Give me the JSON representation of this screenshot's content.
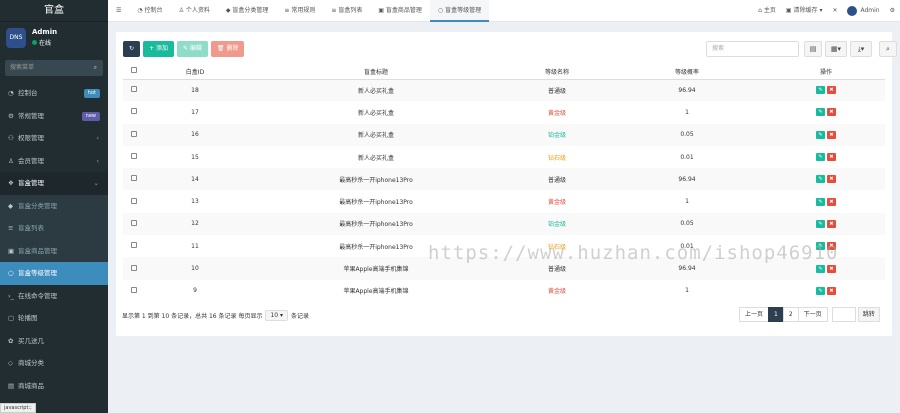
{
  "app": {
    "logo": "官盒",
    "user_name": "Admin",
    "user_status": "在线",
    "avatar_text": "DNS",
    "search_placeholder": "搜索菜单",
    "status_tip": "javascript:;"
  },
  "sidebar": {
    "items": [
      {
        "label": "控制台",
        "badge": "hot",
        "badge_color": "#3c8dbc",
        "icon": "dashboard-icon"
      },
      {
        "label": "常规管理",
        "badge": "new",
        "badge_color": "#605ca8",
        "icon": "cog-icon"
      },
      {
        "label": "权限管理",
        "chevron": "‹",
        "icon": "group-icon"
      },
      {
        "label": "会员管理",
        "chevron": "‹",
        "icon": "user-icon"
      },
      {
        "label": "盲盒管理",
        "chevron": "⌄",
        "icon": "cubes-icon",
        "state": "open"
      },
      {
        "label": "盲盒分类管理",
        "icon": "cube-icon",
        "state": "sub"
      },
      {
        "label": "盲盒列表",
        "icon": "list-icon",
        "state": "sub"
      },
      {
        "label": "盲盒商品管理",
        "icon": "box-icon",
        "state": "sub"
      },
      {
        "label": "盲盒等级管理",
        "icon": "circle-icon",
        "state": "active"
      },
      {
        "label": "在线命令管理",
        "icon": "terminal-icon"
      },
      {
        "label": "轮播图",
        "icon": "image-icon"
      },
      {
        "label": "买几送几",
        "icon": "gift-icon"
      },
      {
        "label": "商城分类",
        "icon": "tag-icon"
      },
      {
        "label": "商城商品",
        "icon": "shop-icon"
      }
    ]
  },
  "tabs": [
    {
      "label": "控制台",
      "icon": "dashboard-icon"
    },
    {
      "label": "个人资料",
      "icon": "user-icon"
    },
    {
      "label": "盲盒分类管理",
      "icon": "cube-icon"
    },
    {
      "label": "常用规则",
      "icon": "list-icon"
    },
    {
      "label": "盲盒列表",
      "icon": "list-icon"
    },
    {
      "label": "盲盒商品管理",
      "icon": "box-icon"
    },
    {
      "label": "盲盒等级管理",
      "icon": "circle-icon",
      "active": true
    }
  ],
  "topright": {
    "home": "主页",
    "clear_cache": "清除缓存",
    "user": "Admin"
  },
  "toolbar": {
    "add": "添加",
    "edit": "编辑",
    "delete": "删除",
    "search_placeholder": "搜索"
  },
  "table": {
    "headers": [
      "白盒ID",
      "盲盒标题",
      "等级名称",
      "等级概率",
      "操作"
    ],
    "rows": [
      {
        "id": "18",
        "title": "新人必买礼盒",
        "level": "普通级",
        "level_color": "#333333",
        "prob": "96.94"
      },
      {
        "id": "17",
        "title": "新人必买礼盒",
        "level": "黄金级",
        "level_color": "#e74c3c",
        "prob": "1"
      },
      {
        "id": "16",
        "title": "新人必买礼盒",
        "level": "铂金级",
        "level_color": "#18bc9c",
        "prob": "0.05"
      },
      {
        "id": "15",
        "title": "新人必买礼盒",
        "level": "钻石级",
        "level_color": "#f39c12",
        "prob": "0.01"
      },
      {
        "id": "14",
        "title": "最高秒杀一开iphone13Pro",
        "level": "普通级",
        "level_color": "#333333",
        "prob": "96.94"
      },
      {
        "id": "13",
        "title": "最高秒杀一开iphone13Pro",
        "level": "黄金级",
        "level_color": "#e74c3c",
        "prob": "1"
      },
      {
        "id": "12",
        "title": "最高秒杀一开iphone13Pro",
        "level": "铂金级",
        "level_color": "#18bc9c",
        "prob": "0.05"
      },
      {
        "id": "11",
        "title": "最高秒杀一开iphone13Pro",
        "level": "钻石级",
        "level_color": "#f39c12",
        "prob": "0.01"
      },
      {
        "id": "10",
        "title": "苹果Apple高端手机集锦",
        "level": "普通级",
        "level_color": "#333333",
        "prob": "96.94"
      },
      {
        "id": "9",
        "title": "苹果Apple高端手机集锦",
        "level": "黄金级",
        "level_color": "#e74c3c",
        "prob": "1"
      }
    ]
  },
  "pagination": {
    "info_prefix": "显示第 1 到第 10 条记录，总共 16 条记录 每页显示",
    "page_size": "10",
    "info_suffix": "条记录",
    "prev": "上一页",
    "page1": "1",
    "page2": "2",
    "next": "下一页",
    "jump": "跳转"
  },
  "watermark": "https://www.huzhan.com/ishop46910"
}
